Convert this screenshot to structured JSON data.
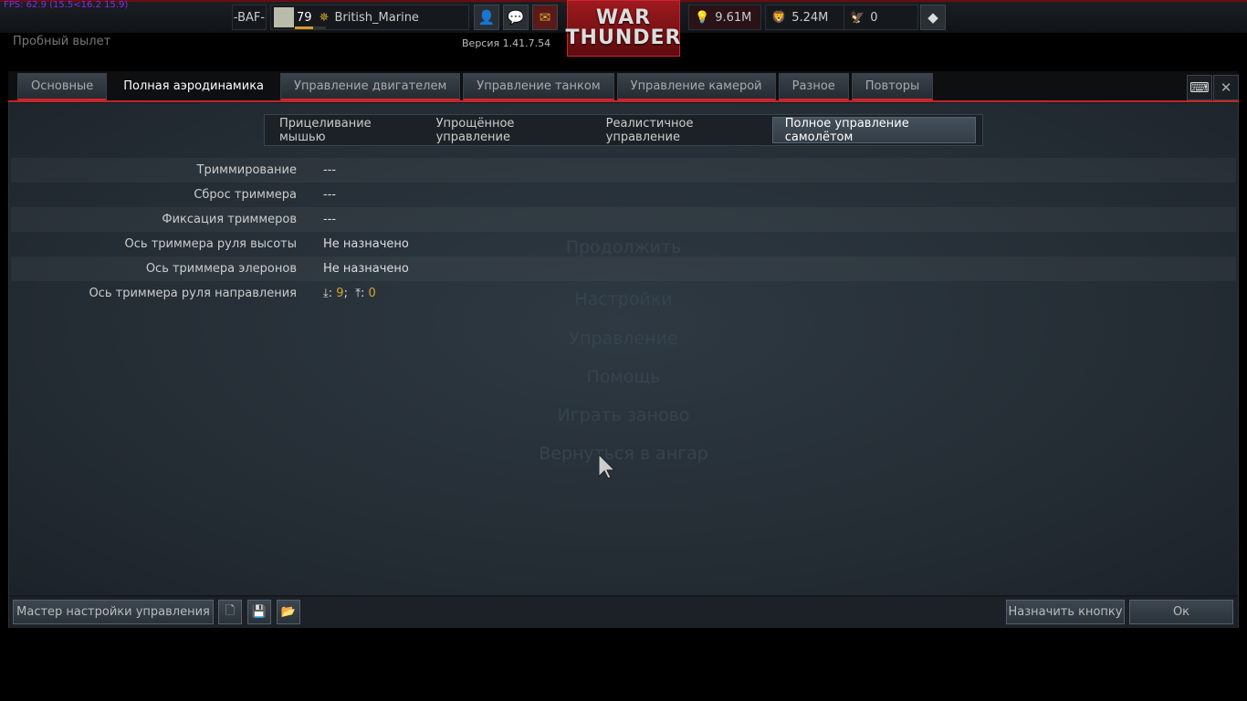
{
  "hud": {
    "fps": "FPS: 62.9 (15.5<16.2 15.9)",
    "clan_tag": "-BAF-",
    "level": "79",
    "username": "British_Marine",
    "level_progress": 0.6,
    "version": "Версия 1.41.7.54",
    "mission": "Пробный вылет",
    "silver_lions": "9.61M",
    "research": "5.24M",
    "golden_eagles": "0",
    "logo_line1": "WAR",
    "logo_line2": "THUNDER"
  },
  "tabs": [
    {
      "label": "Основные"
    },
    {
      "label": "Полная аэродинамика",
      "active": true
    },
    {
      "label": "Управление двигателем"
    },
    {
      "label": "Управление танком"
    },
    {
      "label": "Управление камерой"
    },
    {
      "label": "Разное"
    },
    {
      "label": "Повторы"
    }
  ],
  "subtabs": [
    {
      "label": "Прицеливание мышью"
    },
    {
      "label": "Упрощённое управление"
    },
    {
      "label": "Реалистичное управление"
    },
    {
      "label": "Полное управление самолётом",
      "active": true
    }
  ],
  "rows": [
    {
      "label": "Триммирование",
      "value": "---"
    },
    {
      "label": "Сброс триммера",
      "value": "---"
    },
    {
      "label": "Фиксация триммеров",
      "value": "---"
    },
    {
      "label": "Ось триммера руля высоты",
      "value": "Не назначено"
    },
    {
      "label": "Ось триммера элеронов",
      "value": "Не назначено"
    },
    {
      "label": "Ось триммера руля направления",
      "axis_down": "9",
      "axis_up": "0",
      "sep1": ":",
      "sep2": ";",
      "sep3": ":"
    }
  ],
  "background_menu": [
    "Продолжить",
    "Настройки",
    "Управление",
    "Помощь",
    "Играть заново",
    "Вернуться в ангар"
  ],
  "bottom": {
    "wizard": "Мастер настройки управления",
    "assign": "Назначить кнопку",
    "ok": "Ок"
  }
}
